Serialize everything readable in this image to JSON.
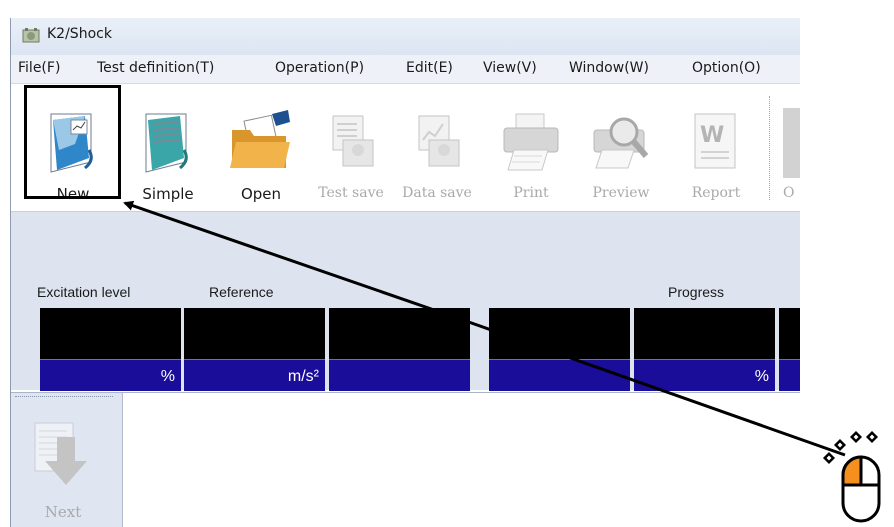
{
  "window": {
    "title": "K2/Shock"
  },
  "menu": [
    "File(F)",
    "Test definition(T)",
    "Operation(P)",
    "Edit(E)",
    "View(V)",
    "Window(W)",
    "Option(O)"
  ],
  "toolbar": {
    "new": "New",
    "simple": "Simple",
    "open": "Open",
    "test_save": "Test save",
    "data_save": "Data save",
    "print": "Print",
    "preview": "Preview",
    "report": "Report",
    "partial": "O"
  },
  "status": {
    "excitation_label": "Excitation level",
    "reference_label": "Reference",
    "progress_label": "Progress",
    "units": [
      "%",
      "m/s²",
      "",
      "",
      "%",
      ""
    ]
  },
  "sidebar": {
    "next": "Next"
  }
}
